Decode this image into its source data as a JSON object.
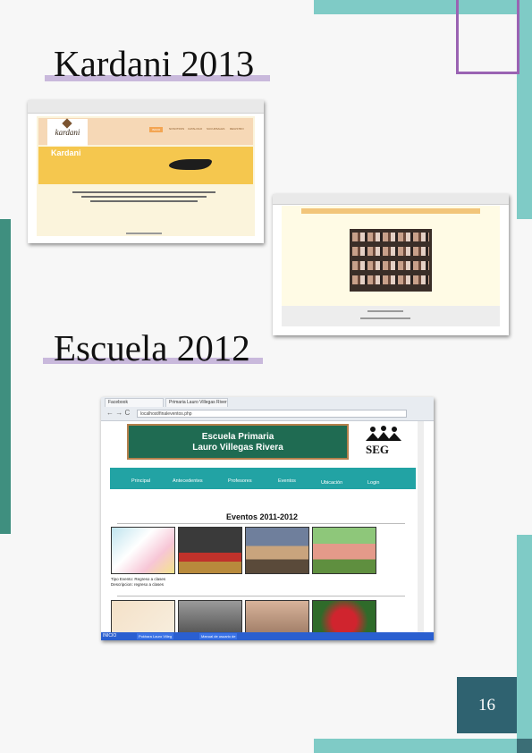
{
  "sections": [
    {
      "title": "Kardani 2013"
    },
    {
      "title": "Escuela 2012"
    }
  ],
  "kardani": {
    "brand": "Kardani",
    "logo": "kardani",
    "nav": [
      "INICIO",
      "NOSOTROS",
      "CATALOGO",
      "SUCURSALES",
      "REGISTRO"
    ],
    "shoe_icon": "shoe-icon"
  },
  "escuela": {
    "tabs": [
      "Facebook",
      "Primaria Lauro Villegas River"
    ],
    "url": "localhost/finaleventos.php",
    "school_line1": "Escuela Primaria",
    "school_line2": "Lauro Villegas Rivera",
    "seg": "SEG",
    "nav": [
      "Principal",
      "Antecedentes",
      "Profesores",
      "Eventos",
      "Ubicación",
      "Login"
    ],
    "events_title": "Eventos 2011-2012",
    "caption1": "Tipo Evento: Regreso a clases",
    "caption2": "Descripcion: regreso a clases",
    "taskbar": [
      "INICIO",
      "Pokhara Lauro Villeg",
      "Manual de usuario de"
    ]
  },
  "page_number": "16",
  "colors": {
    "teal_light": "#7fcbc6",
    "teal_dark": "#2f6270",
    "purple": "#9a63b3",
    "highlight": "#c9b9dc",
    "school_nav": "#22a3a4"
  }
}
